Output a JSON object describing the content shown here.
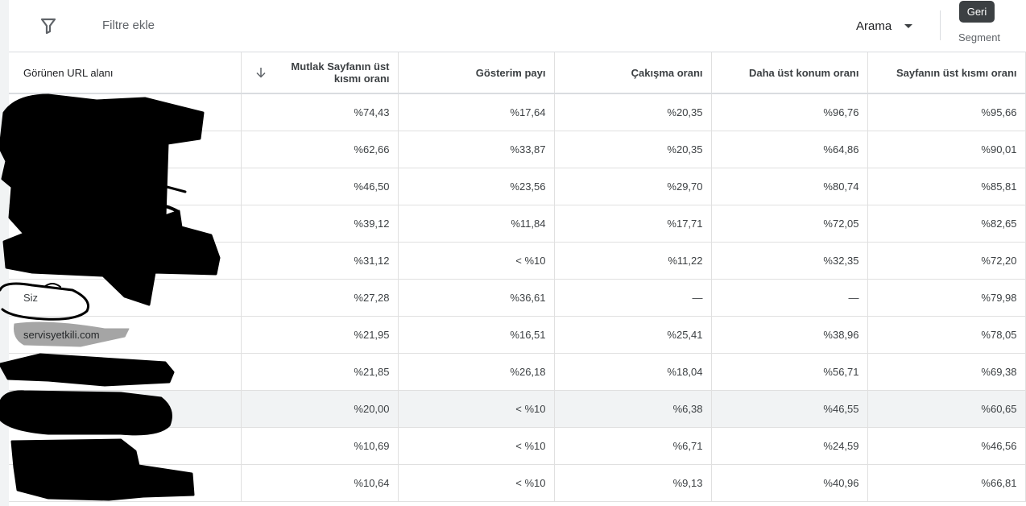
{
  "toolbar": {
    "filter_icon": "filter-icon",
    "filter_placeholder": "Filtre ekle",
    "dropdown_label": "Arama",
    "tooltip": "Geri",
    "segment_label": "Segment"
  },
  "table": {
    "columns": [
      "Görünen URL alanı",
      "Mutlak Sayfanın üst kısmı oranı",
      "Gösterim payı",
      "Çakışma oranı",
      "Daha üst konum oranı",
      "Sayfanın üst kısmı oranı"
    ],
    "sorted_column": "Mutlak Sayfanın üst kısmı oranı",
    "sort_direction": "descending",
    "rows": [
      {
        "url": "",
        "abs_top": "%74,43",
        "impression_share": "%17,64",
        "overlap": "%20,35",
        "position_above": "%96,76",
        "top_of_page": "%95,66"
      },
      {
        "url": "",
        "abs_top": "%62,66",
        "impression_share": "%33,87",
        "overlap": "%20,35",
        "position_above": "%64,86",
        "top_of_page": "%90,01"
      },
      {
        "url": "",
        "abs_top": "%46,50",
        "impression_share": "%23,56",
        "overlap": "%29,70",
        "position_above": "%80,74",
        "top_of_page": "%85,81"
      },
      {
        "url": "",
        "abs_top": "%39,12",
        "impression_share": "%11,84",
        "overlap": "%17,71",
        "position_above": "%72,05",
        "top_of_page": "%82,65"
      },
      {
        "url": "",
        "abs_top": "%31,12",
        "impression_share": "< %10",
        "overlap": "%11,22",
        "position_above": "%32,35",
        "top_of_page": "%72,20"
      },
      {
        "url": "Siz",
        "abs_top": "%27,28",
        "impression_share": "%36,61",
        "overlap": "—",
        "position_above": "—",
        "top_of_page": "%79,98"
      },
      {
        "url": "servisyetkili.com",
        "abs_top": "%21,95",
        "impression_share": "%16,51",
        "overlap": "%25,41",
        "position_above": "%38,96",
        "top_of_page": "%78,05"
      },
      {
        "url": "",
        "abs_top": "%21,85",
        "impression_share": "%26,18",
        "overlap": "%18,04",
        "position_above": "%56,71",
        "top_of_page": "%69,38"
      },
      {
        "url": "",
        "abs_top": "%20,00",
        "impression_share": "< %10",
        "overlap": "%6,38",
        "position_above": "%46,55",
        "top_of_page": "%60,65"
      },
      {
        "url": "",
        "abs_top": "%10,69",
        "impression_share": "< %10",
        "overlap": "%6,71",
        "position_above": "%24,59",
        "top_of_page": "%46,56"
      },
      {
        "url": "",
        "abs_top": "%10,64",
        "impression_share": "< %10",
        "overlap": "%9,13",
        "position_above": "%40,96",
        "top_of_page": "%66,81"
      }
    ]
  },
  "colors": {
    "text": "#3c4043",
    "border": "#e0e0e0",
    "tooltip_bg": "#3c4043",
    "hover_row": "#f1f3f4",
    "redaction": "#000000"
  }
}
